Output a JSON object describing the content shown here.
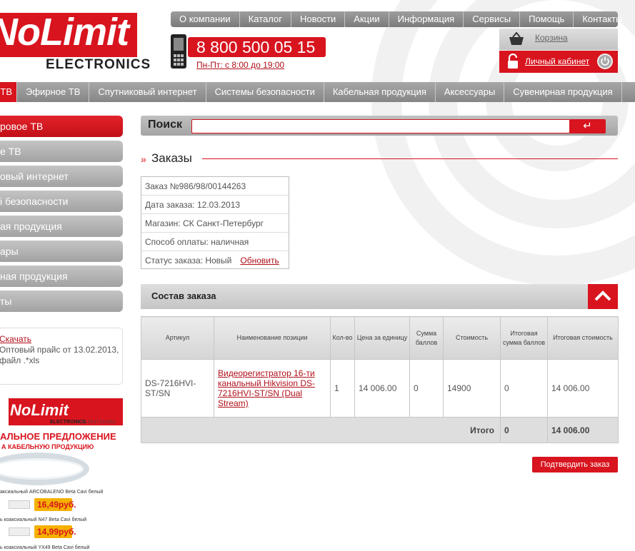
{
  "brand": {
    "logo_text": "NoLimit",
    "logo_sub": "ELECTRONICS"
  },
  "top_nav": [
    "О компании",
    "Каталог",
    "Новости",
    "Акции",
    "Информация",
    "Сервисы",
    "Помощь",
    "Контакты"
  ],
  "contact": {
    "phone": "8 800 500 05 15",
    "hours": "Пн-Пт: с 8:00 до 19:00"
  },
  "cart": {
    "label": "Корзина"
  },
  "cabinet": {
    "label": "Личный кабинет"
  },
  "main_menu": {
    "first": "ТВ",
    "items": [
      "Эфирное ТВ",
      "Спутниковый интернет",
      "Системы безопасности",
      "Кабельная продукция",
      "Аксессуары",
      "Сувенирная продукция"
    ]
  },
  "left_menu": [
    "ровое ТВ",
    "е ТВ",
    "овый интернет",
    "і безопасности",
    "ая продукция",
    "ары",
    "ная продукция",
    "ты"
  ],
  "price": {
    "link": "Скачать",
    "line1": "Оптовый прайс от 13.02.2013,",
    "line2": "файл .*xls"
  },
  "banner": {
    "logo": "NoLimit",
    "elec": "ELECTRONICS",
    "date": "с 01.03-17.03.2013",
    "title": "АЛЬНОЕ ПРЕДЛОЖЕНИЕ",
    "subtitle": "А КАБЕЛЬНУЮ ПРОДУКЦИЮ",
    "p1_name": "аксиальный ARCOBALENO Beta Cavi белый",
    "p1_price": "16,49руб.",
    "p2_name": "ь коаксиальный N47 Beta Cavi белый",
    "p2_price": "14,99руб.",
    "p3_name": "ь коаксиальный YX49 Beta Cavi белый"
  },
  "search": {
    "label": "Поиск",
    "placeholder": "",
    "button": "↵"
  },
  "orders": {
    "title": "Заказы"
  },
  "order_info": {
    "number": "Заказ №986/98/00144263",
    "date": "Дата заказа:  12.03.2013",
    "store": "Магазин:  СК Санкт-Петербург",
    "payment": "Способ оплаты:  наличная",
    "status": "Статус заказа:  Новый",
    "refresh": "Обновить"
  },
  "composition": {
    "title": "Состав заказа"
  },
  "table": {
    "headers": [
      "Артикул",
      "Наименование позиции",
      "Кол-во",
      "Цена за единицу",
      "Сумма баллов",
      "Стоимость",
      "Итоговая сумма баллов",
      "Итоговая стоимость"
    ],
    "row": {
      "article": "DS-7216HVI-ST/SN",
      "name": "Видеорегистратор 16-ти канальный Hikvision DS-7216HVI-ST/SN (Dual Stream)",
      "qty": "1",
      "price": "14 006.00",
      "points": "0",
      "cost": "14900",
      "total_points": "0",
      "total_cost": "14 006.00"
    },
    "total": {
      "label": "Итого",
      "points": "0",
      "cost": "14 006.00"
    }
  },
  "confirm": {
    "label": "Подтвердить заказ"
  },
  "colors": {
    "accent": "#d8141e",
    "gray": "#a4a4a4"
  }
}
